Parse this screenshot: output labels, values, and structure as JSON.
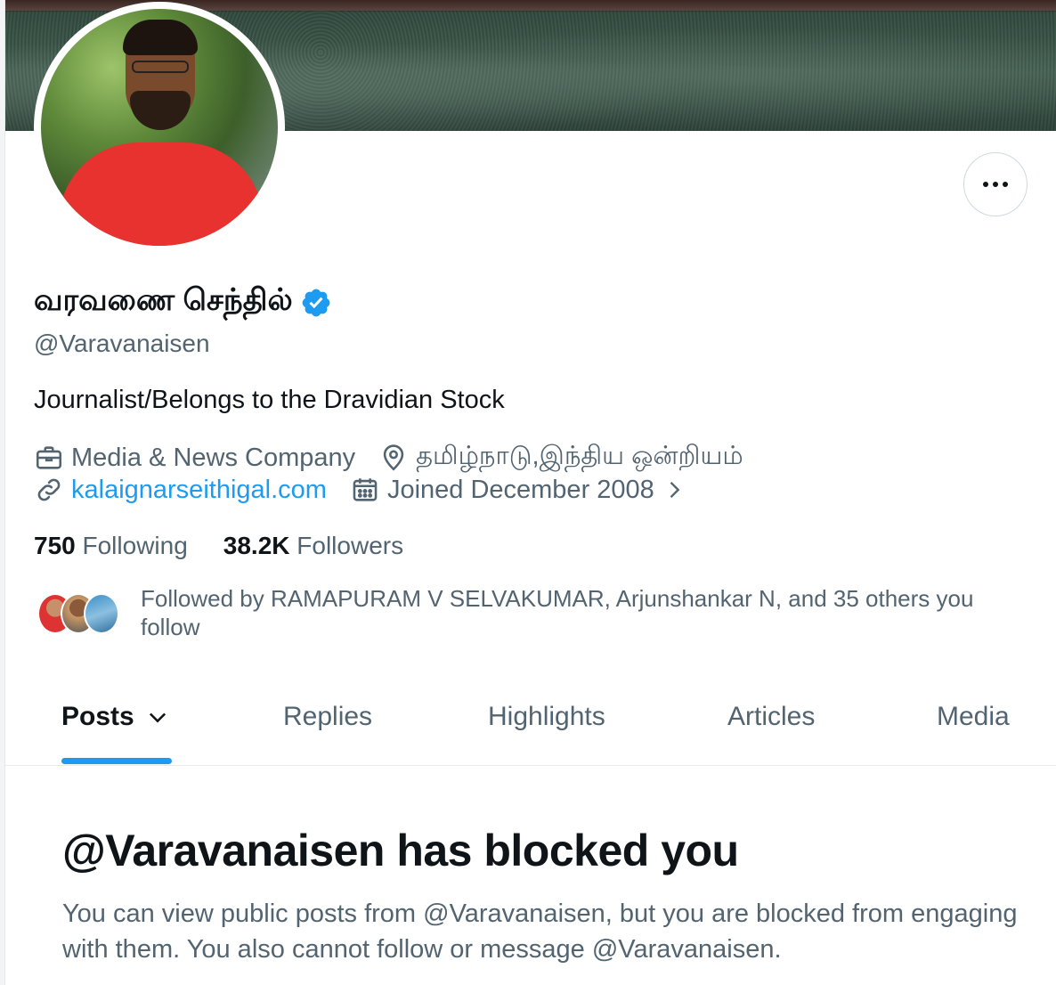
{
  "profile": {
    "display_name": "வரவணை செந்தில்",
    "handle": "@Varavanaisen",
    "bio": "Journalist/Belongs to the Dravidian Stock",
    "category": "Media & News Company",
    "location": "தமிழ்நாடு,இந்திய ஒன்றியம்",
    "website": "kalaignarseithigal.com",
    "joined": "Joined December 2008",
    "verified_color": "#1d9bf0"
  },
  "stats": {
    "following_count": "750",
    "following_label": "Following",
    "followers_count": "38.2K",
    "followers_label": "Followers"
  },
  "followed_by": {
    "text": "Followed by RAMAPURAM V SELVAKUMAR, Arjunshankar N, and 35 others you follow"
  },
  "tabs": [
    {
      "label": "Posts"
    },
    {
      "label": "Replies"
    },
    {
      "label": "Highlights"
    },
    {
      "label": "Articles"
    },
    {
      "label": "Media"
    }
  ],
  "blocked": {
    "title": "@Varavanaisen has blocked you",
    "message": "You can view public posts from @Varavanaisen, but you are blocked from engaging with them. You also cannot follow or message @Varavanaisen."
  },
  "icons": {
    "more": "more-options-icon",
    "verified": "verified-badge-icon",
    "category": "briefcase-icon",
    "location": "location-pin-icon",
    "website": "link-icon",
    "joined": "calendar-icon",
    "joined_arrow": "chevron-right-icon",
    "posts_dropdown": "chevron-down-icon"
  }
}
